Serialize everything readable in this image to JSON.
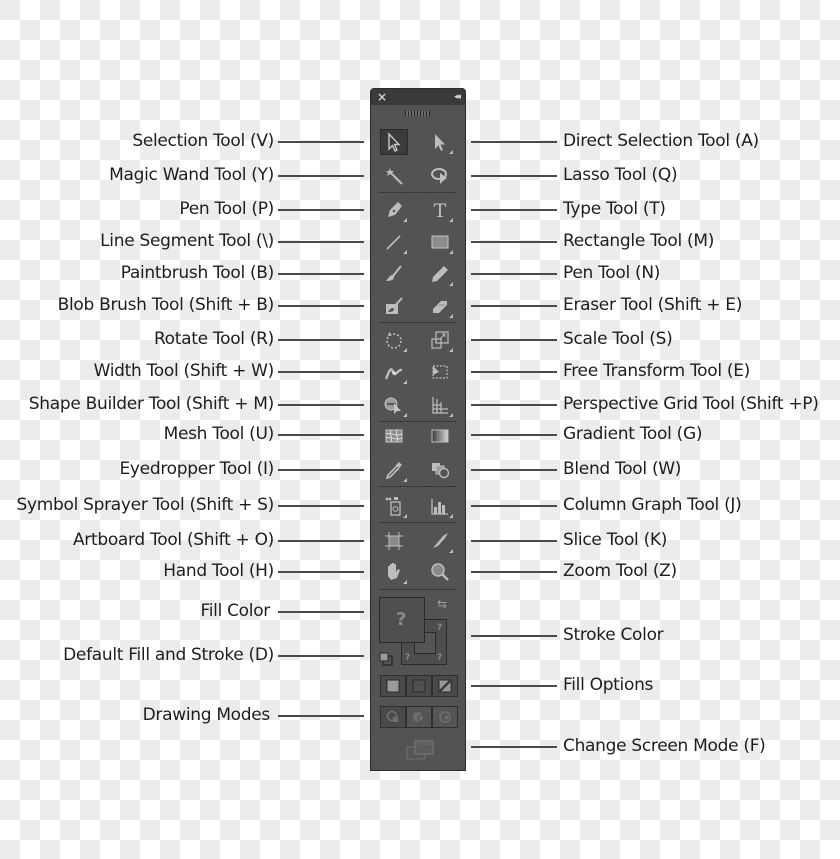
{
  "panel": {
    "title_close_icon": "×",
    "title_collapse_icon": "◂◂"
  },
  "labels_left": [
    {
      "id": "selection",
      "text": "Selection Tool (V)"
    },
    {
      "id": "magic-wand",
      "text": "Magic Wand Tool (Y)"
    },
    {
      "id": "pen",
      "text": "Pen Tool (P)"
    },
    {
      "id": "line-segment",
      "text": "Line Segment Tool (\\)"
    },
    {
      "id": "paintbrush",
      "text": "Paintbrush Tool (B)"
    },
    {
      "id": "blob-brush",
      "text": "Blob Brush Tool (Shift + B)"
    },
    {
      "id": "rotate",
      "text": "Rotate Tool (R)"
    },
    {
      "id": "width",
      "text": "Width Tool (Shift + W)"
    },
    {
      "id": "shape-builder",
      "text": "Shape Builder Tool (Shift + M)"
    },
    {
      "id": "mesh",
      "text": "Mesh Tool (U)"
    },
    {
      "id": "eyedropper",
      "text": "Eyedropper Tool (I)"
    },
    {
      "id": "symbol-sprayer",
      "text": "Symbol Sprayer Tool (Shift + S)"
    },
    {
      "id": "artboard",
      "text": "Artboard Tool (Shift + O)"
    },
    {
      "id": "hand",
      "text": "Hand Tool (H)"
    },
    {
      "id": "fill-color",
      "text": "Fill Color"
    },
    {
      "id": "default-fill-stroke",
      "text": "Default Fill and Stroke (D)"
    },
    {
      "id": "drawing-modes",
      "text": "Drawing Modes"
    }
  ],
  "labels_right": [
    {
      "id": "direct-selection",
      "text": "Direct Selection Tool (A)"
    },
    {
      "id": "lasso",
      "text": "Lasso Tool (Q)"
    },
    {
      "id": "type",
      "text": "Type Tool (T)"
    },
    {
      "id": "rectangle",
      "text": "Rectangle Tool (M)"
    },
    {
      "id": "pencil",
      "text": "Pen Tool (N)"
    },
    {
      "id": "eraser",
      "text": "Eraser Tool (Shift + E)"
    },
    {
      "id": "scale",
      "text": "Scale Tool (S)"
    },
    {
      "id": "free-transform",
      "text": "Free Transform Tool (E)"
    },
    {
      "id": "perspective-grid",
      "text": "Perspective Grid Tool (Shift +P)"
    },
    {
      "id": "gradient",
      "text": "Gradient Tool (G)"
    },
    {
      "id": "blend",
      "text": "Blend Tool (W)"
    },
    {
      "id": "column-graph",
      "text": "Column Graph Tool (J)"
    },
    {
      "id": "slice",
      "text": "Slice Tool (K)"
    },
    {
      "id": "zoom",
      "text": "Zoom Tool (Z)"
    },
    {
      "id": "stroke-color",
      "text": "Stroke Color"
    },
    {
      "id": "fill-options",
      "text": "Fill Options"
    },
    {
      "id": "change-screen-mode",
      "text": "Change Screen Mode (F)"
    }
  ],
  "fill_stroke": {
    "unknown_glyph": "?",
    "swap_glyph": "⇆"
  },
  "active_tool": "selection"
}
